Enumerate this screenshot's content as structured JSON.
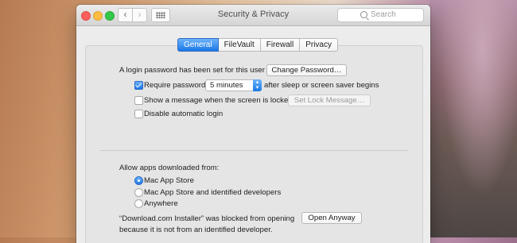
{
  "window": {
    "title": "Security & Privacy"
  },
  "search": {
    "placeholder": "Search"
  },
  "nav": {
    "back_glyph": "‹",
    "forward_glyph": "›"
  },
  "tabs": [
    {
      "label": "General",
      "active": true
    },
    {
      "label": "FileVault",
      "active": false
    },
    {
      "label": "Firewall",
      "active": false
    },
    {
      "label": "Privacy",
      "active": false
    }
  ],
  "login": {
    "text": "A login password has been set for this user",
    "change_password_label": "Change Password…"
  },
  "require_password": {
    "checked": true,
    "label": "Require password",
    "value": "5 minutes",
    "suffix": "after sleep or screen saver begins"
  },
  "lock_message": {
    "checked": false,
    "label": "Show a message when the screen is locked",
    "button_label": "Set Lock Message…"
  },
  "auto_login": {
    "checked": false,
    "label": "Disable automatic login"
  },
  "allow_apps": {
    "heading": "Allow apps downloaded from:",
    "options": [
      {
        "label": "Mac App Store",
        "selected": true
      },
      {
        "label": "Mac App Store and identified developers",
        "selected": false
      },
      {
        "label": "Anywhere",
        "selected": false
      }
    ]
  },
  "blocked": {
    "line1": "“Download.com Installer” was blocked from opening",
    "line2": "because it is not from an identified developer.",
    "open_anyway_label": "Open Anyway"
  },
  "colors": {
    "accent": "#1b78e5",
    "window_bg": "#ececec"
  }
}
